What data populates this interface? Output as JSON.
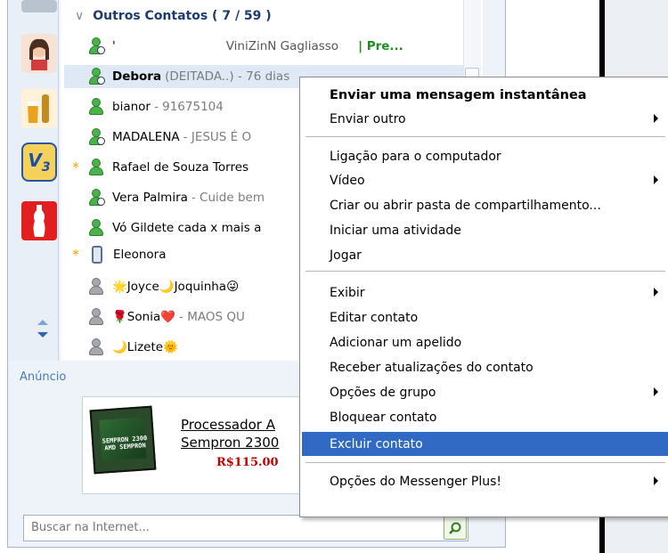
{
  "contacts_group": {
    "collapse_glyph": "∨",
    "title": "Outros Contatos ( 7 / 59 )"
  },
  "contacts": [
    {
      "star": "",
      "icon": "green-clock-icon",
      "name": "'",
      "msg": "ViniZinN  Gagliasso",
      "tail": "| Pre...",
      "bold": false
    },
    {
      "star": "",
      "icon": "green-clock-icon",
      "name": "Debora",
      "msg": "(DEITADA..) - 76 dias",
      "tail": "",
      "bold": true
    },
    {
      "star": "",
      "icon": "green-icon",
      "name": "bianor",
      "msg": "- 91675104",
      "tail": "",
      "bold": false
    },
    {
      "star": "",
      "icon": "green-clock-icon",
      "name": "MADALENA",
      "msg": "- JESUS É O",
      "tail": "",
      "bold": false
    },
    {
      "star": "*",
      "icon": "green-icon",
      "name": "Rafael de Souza Torres",
      "msg": "",
      "tail": "",
      "bold": false
    },
    {
      "star": "",
      "icon": "green-clock-icon",
      "name": "Vera Palmira",
      "msg": "- Cuide bem",
      "tail": "",
      "bold": false
    },
    {
      "star": "",
      "icon": "green-icon",
      "name": "Vó Gildete cada x mais a",
      "msg": "",
      "tail": "",
      "bold": false
    },
    {
      "star": "*",
      "icon": "mobile-icon",
      "name": "Eleonora",
      "msg": "",
      "tail": "",
      "bold": false
    },
    {
      "star": "",
      "icon": "grey-icon",
      "name": "🌟Joyce🌙Joquinha😜",
      "msg": "",
      "tail": "",
      "bold": false
    },
    {
      "star": "",
      "icon": "grey-icon",
      "name": "🌹Sonia❤️",
      "msg": "- MAOS QU",
      "tail": "",
      "bold": false
    },
    {
      "star": "",
      "icon": "grey-icon",
      "name": "🌙Lizete🌞",
      "msg": "",
      "tail": "",
      "bold": false
    }
  ],
  "ad": {
    "label": "Anúncio",
    "title1": "Processador A",
    "title2": "Sempron 2300",
    "price": "R$115.00",
    "image_text": "SEMPRON 2300\nAMD SEMPRON"
  },
  "search": {
    "placeholder": "Buscar na Internet..."
  },
  "context_menu": {
    "items": [
      {
        "label": "Enviar uma mensagem instantânea",
        "bold": true,
        "submenu": false,
        "highlight": false
      },
      {
        "label": "Enviar outro",
        "bold": false,
        "submenu": true,
        "highlight": false
      },
      {
        "label": "Ligação para o computador",
        "bold": false,
        "submenu": false,
        "highlight": false
      },
      {
        "label": "Vídeo",
        "bold": false,
        "submenu": true,
        "highlight": false
      },
      {
        "label": "Criar ou abrir pasta de compartilhamento...",
        "bold": false,
        "submenu": false,
        "highlight": false
      },
      {
        "label": "Iniciar uma atividade",
        "bold": false,
        "submenu": false,
        "highlight": false
      },
      {
        "label": "Jogar",
        "bold": false,
        "submenu": false,
        "highlight": false
      },
      {
        "label": "Exibir",
        "bold": false,
        "submenu": true,
        "highlight": false
      },
      {
        "label": "Editar contato",
        "bold": false,
        "submenu": false,
        "highlight": false
      },
      {
        "label": "Adicionar um apelido",
        "bold": false,
        "submenu": false,
        "highlight": false
      },
      {
        "label": "Receber atualizações do contato",
        "bold": false,
        "submenu": false,
        "highlight": false
      },
      {
        "label": "Opções de grupo",
        "bold": false,
        "submenu": true,
        "highlight": false
      },
      {
        "label": "Bloquear contato",
        "bold": false,
        "submenu": false,
        "highlight": false
      },
      {
        "label": "Excluir contato",
        "bold": false,
        "submenu": false,
        "highlight": true
      },
      {
        "label": "Opções do Messenger Plus!",
        "bold": false,
        "submenu": true,
        "highlight": false
      }
    ]
  },
  "colors": {
    "menu_highlight": "#316ac5",
    "status_green": "#4ab24a",
    "status_grey": "#a5a9ad",
    "group_header": "#1c3b70",
    "ad_price": "#c00000",
    "ad_label": "#4a7ab8"
  }
}
